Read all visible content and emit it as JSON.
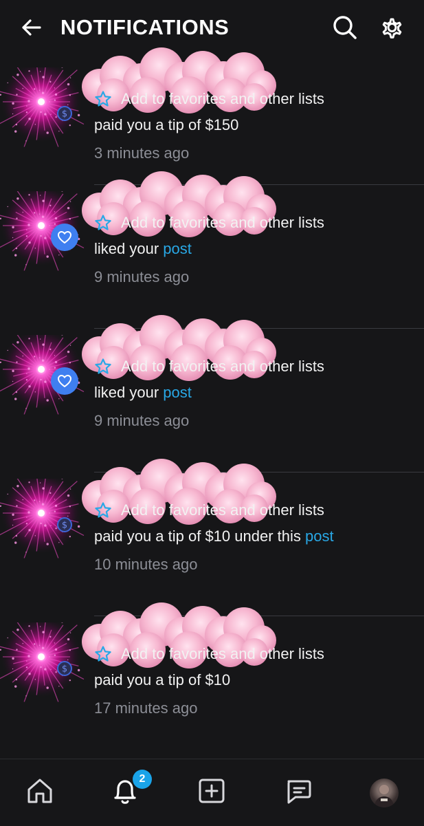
{
  "header": {
    "title": "NOTIFICATIONS",
    "back_icon": "arrow-left-icon",
    "search_icon": "search-icon",
    "settings_icon": "gear-icon"
  },
  "notifications": [
    {
      "badge": "dollar",
      "favorites_label": "Add to favorites and other lists",
      "message": "paid you a tip of $150",
      "link": "",
      "time": "3 minutes ago"
    },
    {
      "badge": "heart",
      "favorites_label": "Add to favorites and other lists",
      "message": "liked your ",
      "link": "post",
      "time": "9 minutes ago"
    },
    {
      "badge": "heart",
      "favorites_label": "Add to favorites and other lists",
      "message": "liked your ",
      "link": "post",
      "time": "9 minutes ago"
    },
    {
      "badge": "dollar",
      "favorites_label": "Add to favorites and other lists",
      "message": "paid you a tip of $10 under this ",
      "link": "post",
      "time": "10 minutes ago"
    },
    {
      "badge": "dollar",
      "favorites_label": "Add to favorites and other lists",
      "message": "paid you a tip of $10",
      "link": "",
      "time": "17 minutes ago"
    }
  ],
  "tabbar": {
    "home_icon": "home-icon",
    "notifications_icon": "bell-icon",
    "notifications_count": "2",
    "create_icon": "plus-square-icon",
    "messages_icon": "chat-icon",
    "profile_icon": "avatar"
  },
  "colors": {
    "background": "#161618",
    "link": "#29a8e6",
    "time": "#8c8e96",
    "accent": "#1aa3e8",
    "like_badge": "#3f7ff0"
  }
}
